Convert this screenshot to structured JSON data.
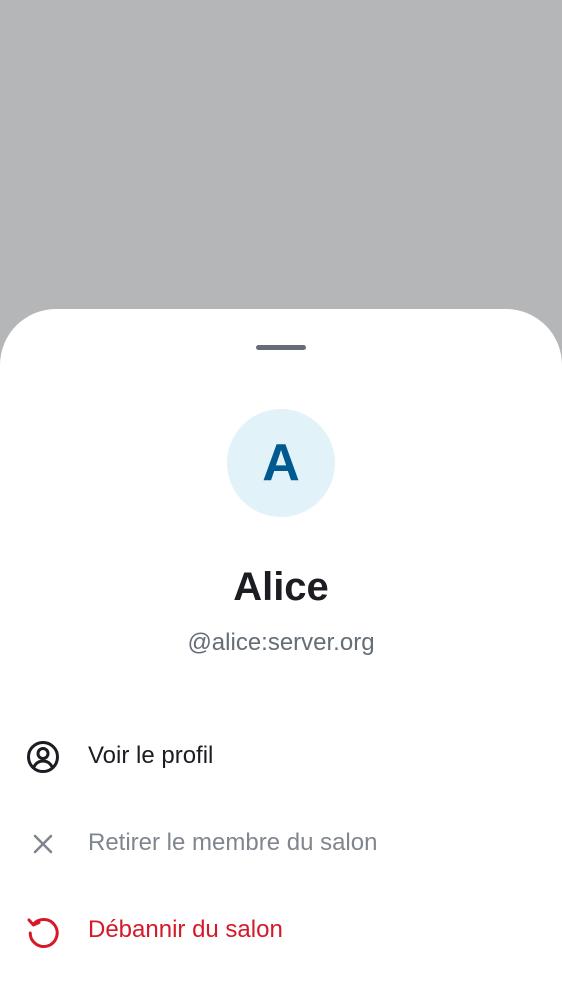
{
  "member": {
    "avatar_initial": "A",
    "display_name": "Alice",
    "user_id": "@alice:server.org"
  },
  "actions": [
    {
      "label": "Voir le profil",
      "icon": "user-profile-icon",
      "enabled": true
    },
    {
      "label": "Retirer le membre du salon",
      "icon": "close-icon",
      "enabled": false
    },
    {
      "label": "Débannir du salon",
      "icon": "unban-restore-icon",
      "enabled": true
    }
  ],
  "colors": {
    "scrim": "#b5b6b8",
    "sheet": "#ffffff",
    "avatar_bg": "#e1f2f8",
    "avatar_text": "#005a8f",
    "primary_text": "#1b1d22",
    "secondary_text": "#656d77",
    "disabled_text": "#80868f",
    "critical": "#d51928"
  }
}
